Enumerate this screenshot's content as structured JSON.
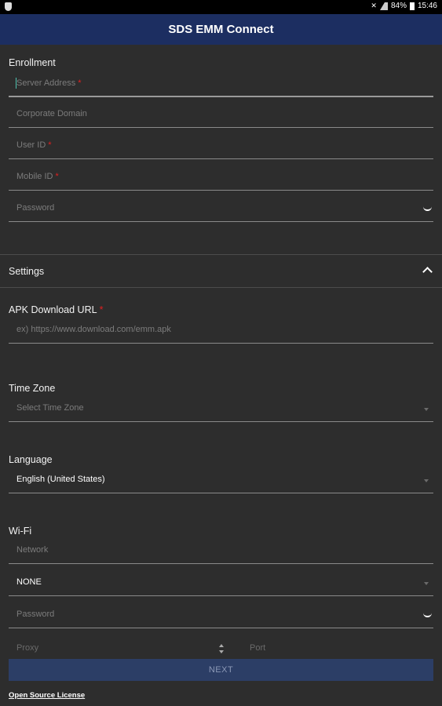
{
  "status_bar": {
    "battery": "84%",
    "time": "15:46"
  },
  "app_bar": {
    "title": "SDS EMM Connect"
  },
  "enrollment": {
    "title": "Enrollment",
    "server_address": {
      "placeholder": "Server Address",
      "required": "*"
    },
    "corporate_domain": {
      "placeholder": "Corporate Domain"
    },
    "user_id": {
      "placeholder": "User ID",
      "required": "*"
    },
    "mobile_id": {
      "placeholder": "Mobile ID",
      "required": "*"
    },
    "password": {
      "placeholder": "Password"
    }
  },
  "settings": {
    "title": "Settings",
    "apk_url": {
      "label": "APK Download URL",
      "required": "*",
      "placeholder": "ex) https://www.download.com/emm.apk"
    },
    "time_zone": {
      "label": "Time Zone",
      "placeholder": "Select Time Zone"
    },
    "language": {
      "label": "Language",
      "value": "English (United States)"
    },
    "wifi": {
      "label": "Wi-Fi",
      "network_placeholder": "Network",
      "security_value": "NONE",
      "password_placeholder": "Password",
      "proxy_placeholder": "Proxy",
      "port_placeholder": "Port"
    }
  },
  "actions": {
    "next_label": "NEXT",
    "open_source_label": "Open Source License"
  },
  "colors": {
    "app_bar": "#1c2e61",
    "background": "#2d2d2d",
    "required": "#e02020",
    "button": "#2c3e66"
  }
}
